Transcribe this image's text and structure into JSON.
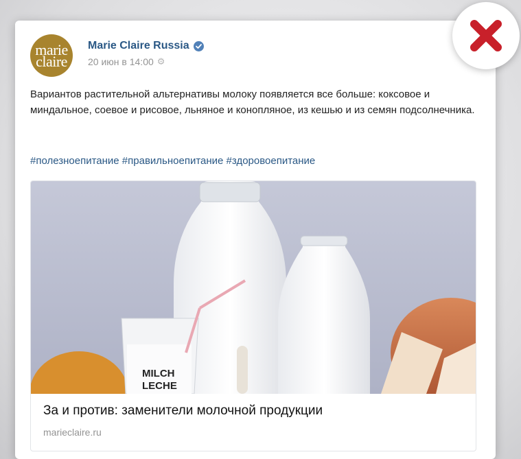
{
  "post": {
    "author": "Marie Claire Russia",
    "avatar_text_line1": "marie",
    "avatar_text_line2": "claire",
    "date": "20 июн в 14:00",
    "text": "Вариантов растительной альтернативы молоку появляется все больше: коксовое и миндальное, соевое и рисовое, льняное и конопляное, из кешью и из семян подсолнечника.",
    "hashtags": "#полезноепитание #правильноепитание #здоровоепитание",
    "verified_icon": "verified-check-icon",
    "settings_icon": "gear-icon"
  },
  "link_snippet": {
    "title": "За и против: заменители молочной продукции",
    "domain": "marieclaire.ru",
    "image_label_line1": "MILCH",
    "image_label_line2": "LECHE"
  },
  "overlay": {
    "icon": "red-x-icon",
    "color": "#c8202a"
  },
  "colors": {
    "link": "#2a5885",
    "avatar_bg": "#a8842e",
    "meta_gray": "#939393"
  }
}
